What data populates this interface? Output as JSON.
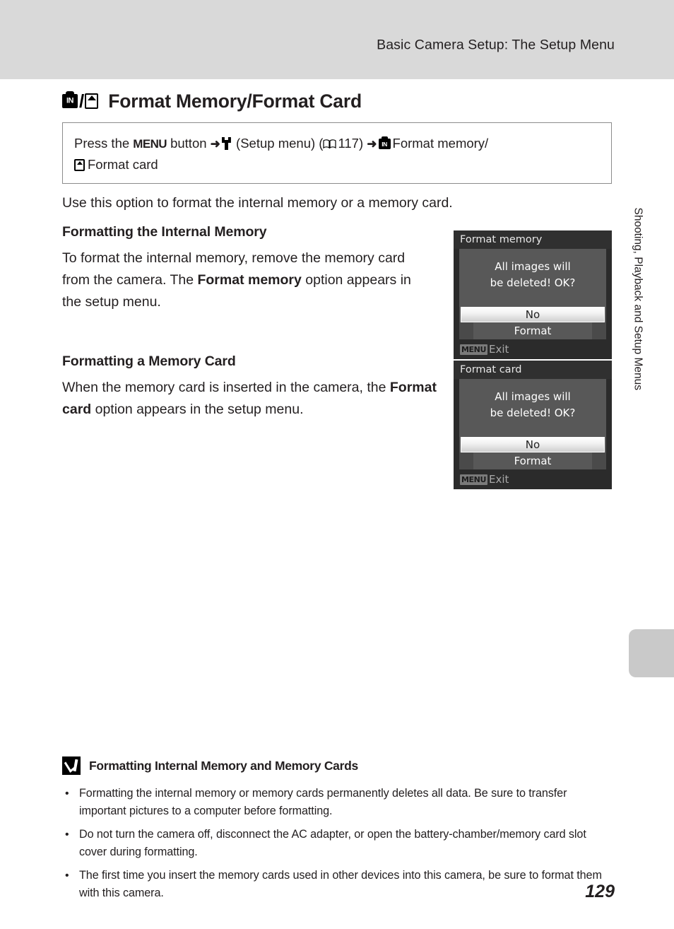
{
  "header": {
    "running_title": "Basic Camera Setup: The Setup Menu"
  },
  "page_title": {
    "icon_in_label": "IN",
    "separator": "/",
    "text": "Format Memory/Format Card"
  },
  "instruction_box": {
    "line1_a": "Press the ",
    "line1_menu": "MENU",
    "line1_b": " button ",
    "line1_arrow1": "➜",
    "line1_c": " (Setup menu) (",
    "line1_page_ref": "117",
    "line1_d": ") ",
    "line1_arrow2": "➜",
    "line1_in_label": "IN",
    "line1_e": "Format memory/",
    "line2": "Format card"
  },
  "intro": {
    "text": "Use this option to format the internal memory or a memory card."
  },
  "sections": [
    {
      "heading": "Formatting the Internal Memory",
      "body_part1": "To format the internal memory, remove the memory card from the camera. The ",
      "body_bold": "Format memory",
      "body_part2": " option appears in the setup menu."
    },
    {
      "heading": "Formatting a Memory Card",
      "body_part1": "When the memory card is inserted in the camera, the ",
      "body_bold": "Format card",
      "body_part2": " option appears in the setup menu."
    }
  ],
  "camera_screens": [
    {
      "title": "Format memory",
      "message_line1": "All images will",
      "message_line2": "be deleted! OK?",
      "option_selected": "No",
      "option_other": "Format",
      "footer_badge": "MENU",
      "footer_label": "Exit"
    },
    {
      "title": "Format card",
      "message_line1": "All images will",
      "message_line2": "be deleted! OK?",
      "option_selected": "No",
      "option_other": "Format",
      "footer_badge": "MENU",
      "footer_label": "Exit"
    }
  ],
  "side_tab": {
    "text": "Shooting, Playback and Setup Menus"
  },
  "notes": {
    "heading": "Formatting Internal Memory and Memory Cards",
    "bullet": "•",
    "items": [
      "Formatting the internal memory or memory cards permanently deletes all data. Be sure to transfer important pictures to a computer before formatting.",
      "Do not turn the camera off, disconnect the AC adapter, or open the battery-chamber/memory card slot cover during formatting.",
      "The first time you insert the memory cards used in other devices into this camera, be sure to format them with this camera."
    ]
  },
  "page_number": "129",
  "colors": {
    "header_band": "#d9d9d9",
    "text": "#231f20",
    "screen_titlebar": "#303030",
    "screen_panel": "#585858",
    "screen_background": "#2b2b2b",
    "tab_marker": "#c9c9c9"
  }
}
